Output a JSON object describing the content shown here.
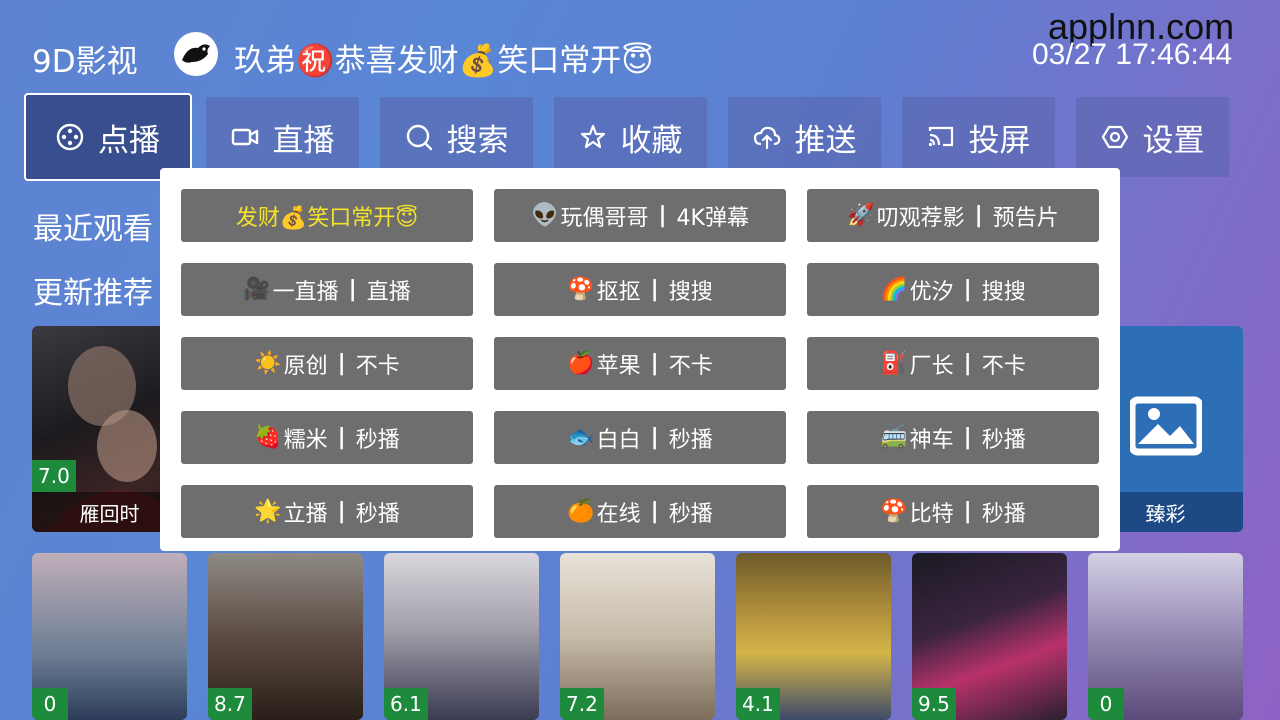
{
  "header": {
    "brand": "9D影视",
    "marquee": "玖弟㊗️恭喜发财💰笑口常开😇",
    "clock": "03/27 17:46:44",
    "watermark": "applnn.com"
  },
  "nav": [
    {
      "label": "点播",
      "icon": "film-reel-icon"
    },
    {
      "label": "直播",
      "icon": "video-camera-icon"
    },
    {
      "label": "搜索",
      "icon": "search-icon"
    },
    {
      "label": "收藏",
      "icon": "star-icon"
    },
    {
      "label": "推送",
      "icon": "cloud-upload-icon"
    },
    {
      "label": "投屏",
      "icon": "cast-icon"
    },
    {
      "label": "设置",
      "icon": "gear-icon"
    }
  ],
  "sections": {
    "recent": "最近观看",
    "updates": "更新推荐"
  },
  "row1": [
    {
      "title": "雁回时",
      "rating": "7.0"
    },
    {
      "title": "臻彩",
      "rating": ""
    }
  ],
  "row2": [
    {
      "rating": "0"
    },
    {
      "rating": "8.7"
    },
    {
      "rating": "6.1"
    },
    {
      "rating": "7.2"
    },
    {
      "rating": "4.1"
    },
    {
      "rating": "9.5"
    },
    {
      "rating": "0"
    }
  ],
  "sources": [
    {
      "emoji": "",
      "name": "发财💰笑口常开😇",
      "tag": ""
    },
    {
      "emoji": "👽",
      "name": "玩偶哥哥",
      "tag": "4K弹幕"
    },
    {
      "emoji": "🚀",
      "name": "叨观荐影",
      "tag": "预告片"
    },
    {
      "emoji": "🎥",
      "name": "一直播",
      "tag": "直播"
    },
    {
      "emoji": "🍄",
      "name": "抠抠",
      "tag": "搜搜"
    },
    {
      "emoji": "🌈",
      "name": "优汐",
      "tag": "搜搜"
    },
    {
      "emoji": "☀️",
      "name": "原创",
      "tag": "不卡"
    },
    {
      "emoji": "🍎",
      "name": "苹果",
      "tag": "不卡"
    },
    {
      "emoji": "⛽",
      "name": "厂长",
      "tag": "不卡"
    },
    {
      "emoji": "🍓",
      "name": "糯米",
      "tag": "秒播"
    },
    {
      "emoji": "🐟",
      "name": "白白",
      "tag": "秒播"
    },
    {
      "emoji": "🚎",
      "name": "神车",
      "tag": "秒播"
    },
    {
      "emoji": "🌟",
      "name": "立播",
      "tag": "秒播"
    },
    {
      "emoji": "🍊",
      "name": "在线",
      "tag": "秒播"
    },
    {
      "emoji": "🍄",
      "name": "比特",
      "tag": "秒播"
    }
  ],
  "separator": "|",
  "colors": {
    "selected_source_text": "#f5e22b",
    "rating_badge": "#1e8a3c"
  }
}
